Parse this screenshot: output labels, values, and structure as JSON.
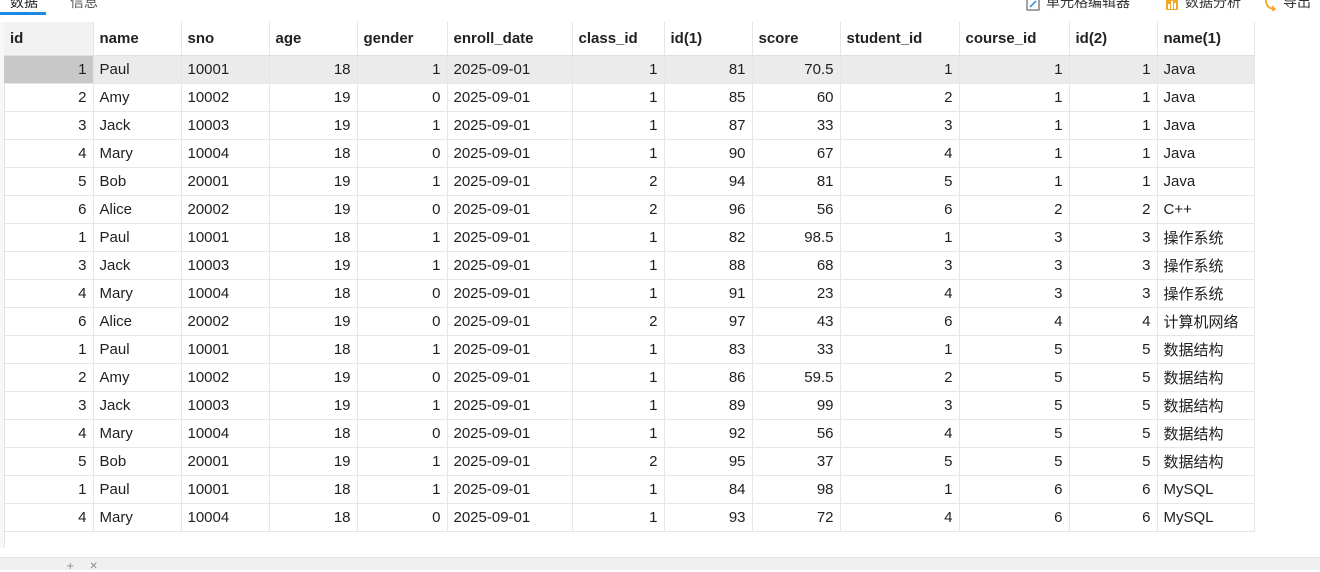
{
  "tabs": [
    {
      "label": "数据",
      "active": true
    },
    {
      "label": "信息",
      "active": false
    }
  ],
  "toolbar": {
    "cell_editor": {
      "label": "单元格编辑器",
      "icon": "edit-icon"
    },
    "data_analysis": {
      "label": "数据分析",
      "icon": "bar-chart-icon"
    },
    "export": {
      "label": "导出",
      "icon": "export-icon"
    }
  },
  "colors": {
    "accent": "#1e88e5",
    "selected_row": "#ebebeb",
    "selected_cell": "#c8c8c8",
    "grid_line": "#e6e6e6"
  },
  "table": {
    "columns": [
      "id",
      "name",
      "sno",
      "age",
      "gender",
      "enroll_date",
      "class_id",
      "id(1)",
      "score",
      "student_id",
      "course_id",
      "id(2)",
      "name(1)"
    ],
    "rows": [
      [
        "1",
        "Paul",
        "10001",
        "18",
        "1",
        "2025-09-01",
        "1",
        "81",
        "70.5",
        "1",
        "1",
        "1",
        "Java"
      ],
      [
        "2",
        "Amy",
        "10002",
        "19",
        "0",
        "2025-09-01",
        "1",
        "85",
        "60",
        "2",
        "1",
        "1",
        "Java"
      ],
      [
        "3",
        "Jack",
        "10003",
        "19",
        "1",
        "2025-09-01",
        "1",
        "87",
        "33",
        "3",
        "1",
        "1",
        "Java"
      ],
      [
        "4",
        "Mary",
        "10004",
        "18",
        "0",
        "2025-09-01",
        "1",
        "90",
        "67",
        "4",
        "1",
        "1",
        "Java"
      ],
      [
        "5",
        "Bob",
        "20001",
        "19",
        "1",
        "2025-09-01",
        "2",
        "94",
        "81",
        "5",
        "1",
        "1",
        "Java"
      ],
      [
        "6",
        "Alice",
        "20002",
        "19",
        "0",
        "2025-09-01",
        "2",
        "96",
        "56",
        "6",
        "2",
        "2",
        "C++"
      ],
      [
        "1",
        "Paul",
        "10001",
        "18",
        "1",
        "2025-09-01",
        "1",
        "82",
        "98.5",
        "1",
        "3",
        "3",
        "操作系统"
      ],
      [
        "3",
        "Jack",
        "10003",
        "19",
        "1",
        "2025-09-01",
        "1",
        "88",
        "68",
        "3",
        "3",
        "3",
        "操作系统"
      ],
      [
        "4",
        "Mary",
        "10004",
        "18",
        "0",
        "2025-09-01",
        "1",
        "91",
        "23",
        "4",
        "3",
        "3",
        "操作系统"
      ],
      [
        "6",
        "Alice",
        "20002",
        "19",
        "0",
        "2025-09-01",
        "2",
        "97",
        "43",
        "6",
        "4",
        "4",
        "计算机网络"
      ],
      [
        "1",
        "Paul",
        "10001",
        "18",
        "1",
        "2025-09-01",
        "1",
        "83",
        "33",
        "1",
        "5",
        "5",
        "数据结构"
      ],
      [
        "2",
        "Amy",
        "10002",
        "19",
        "0",
        "2025-09-01",
        "1",
        "86",
        "59.5",
        "2",
        "5",
        "5",
        "数据结构"
      ],
      [
        "3",
        "Jack",
        "10003",
        "19",
        "1",
        "2025-09-01",
        "1",
        "89",
        "99",
        "3",
        "5",
        "5",
        "数据结构"
      ],
      [
        "4",
        "Mary",
        "10004",
        "18",
        "0",
        "2025-09-01",
        "1",
        "92",
        "56",
        "4",
        "5",
        "5",
        "数据结构"
      ],
      [
        "5",
        "Bob",
        "20001",
        "19",
        "1",
        "2025-09-01",
        "2",
        "95",
        "37",
        "5",
        "5",
        "5",
        "数据结构"
      ],
      [
        "1",
        "Paul",
        "10001",
        "18",
        "1",
        "2025-09-01",
        "1",
        "84",
        "98",
        "1",
        "6",
        "6",
        "MySQL"
      ],
      [
        "4",
        "Mary",
        "10004",
        "18",
        "0",
        "2025-09-01",
        "1",
        "93",
        "72",
        "4",
        "6",
        "6",
        "MySQL"
      ]
    ]
  }
}
